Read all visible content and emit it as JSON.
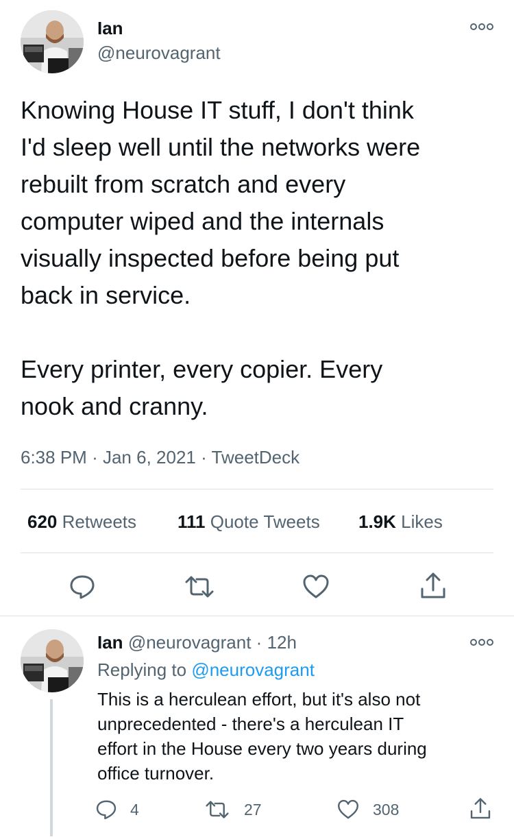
{
  "main_tweet": {
    "author_name": "Ian",
    "author_handle": "@neurovagrant",
    "text": "Knowing House IT stuff, I don't think\nI'd sleep well until the networks were\nrebuilt from scratch and every\ncomputer wiped and the internals\nvisually inspected before being put\nback in service.\n\nEvery printer, every copier. Every\nnook and cranny.",
    "time": "6:38 PM",
    "date": "Jan 6, 2021",
    "source": "TweetDeck",
    "sep": "·",
    "stats": {
      "retweets_count": "620",
      "retweets_label": "Retweets",
      "quotes_count": "111",
      "quotes_label": "Quote Tweets",
      "likes_count": "1.9K",
      "likes_label": "Likes"
    },
    "icons": [
      "reply-icon",
      "retweet-icon",
      "like-icon",
      "share-icon",
      "more-icon"
    ]
  },
  "reply_tweet": {
    "author_name": "Ian",
    "author_handle": "@neurovagrant",
    "sep": "·",
    "age": "12h",
    "replying_prefix": "Replying to",
    "replying_to": "@neurovagrant",
    "text": "This is a herculean effort, but it's also not\nunprecedented - there's a herculean IT\neffort in the House every two years during\noffice turnover.",
    "counts": {
      "replies": "4",
      "retweets": "27",
      "likes": "308"
    }
  },
  "colors": {
    "text": "#0f1419",
    "secondary": "#536471",
    "link": "#1d9bf0",
    "divider": "#dfe3e8"
  }
}
